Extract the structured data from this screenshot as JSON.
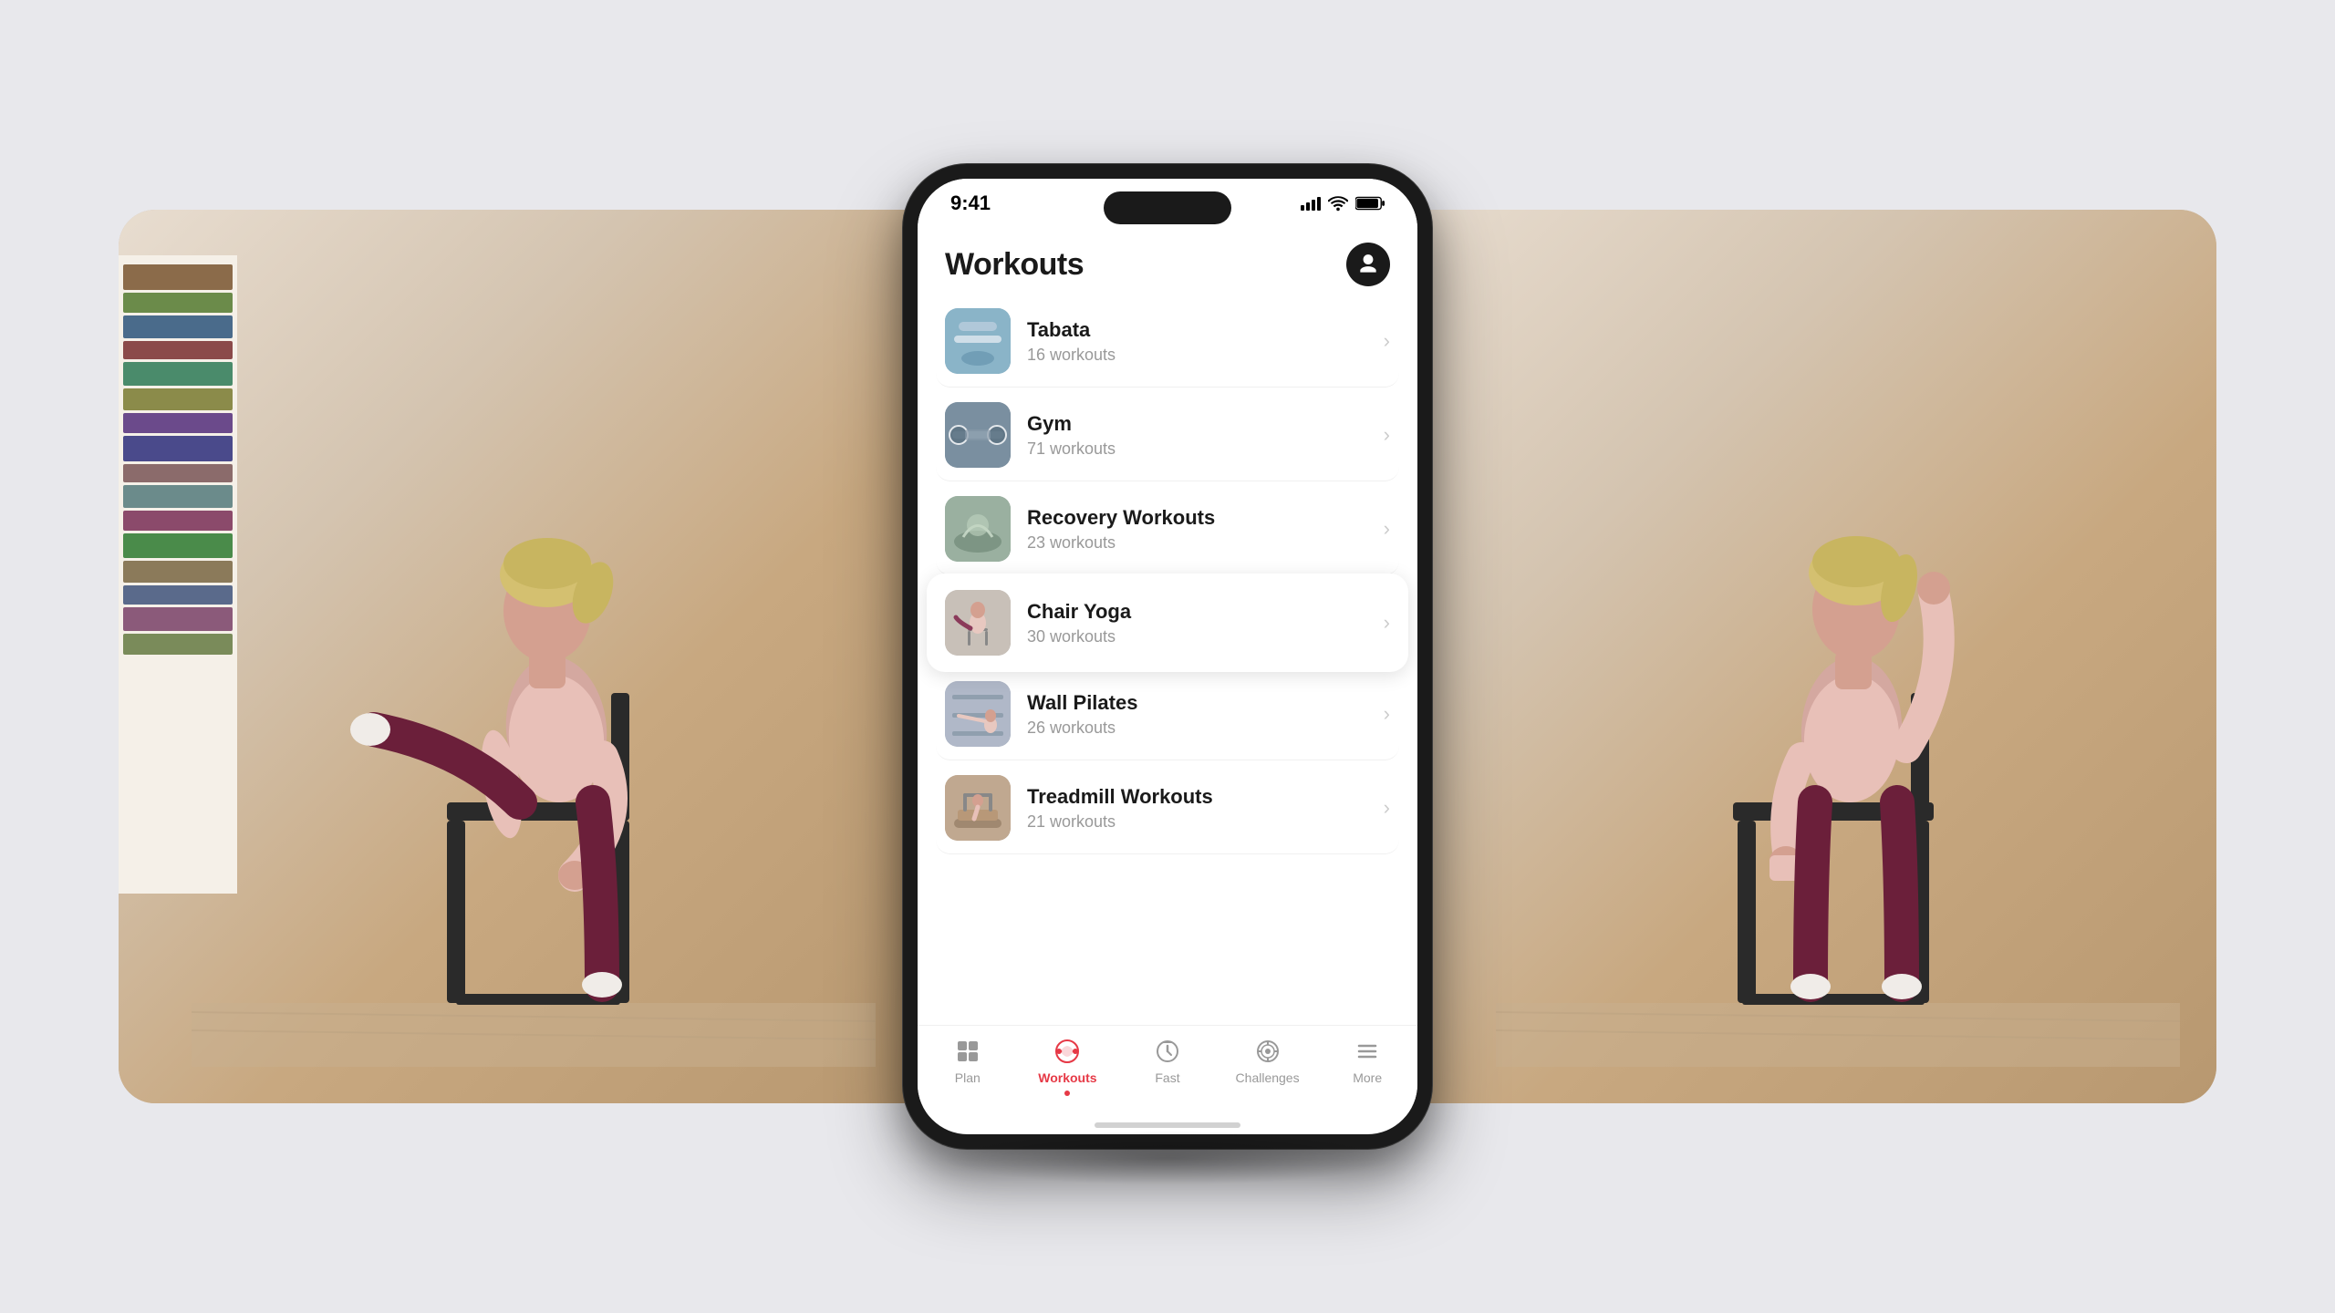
{
  "app": {
    "title": "Workouts",
    "time": "9:41"
  },
  "header": {
    "title": "Workouts",
    "profile_icon": "person-circle"
  },
  "workouts": [
    {
      "id": "tabata",
      "name": "Tabata",
      "count": "16 workouts",
      "thumb_class": "thumb-tabata",
      "highlighted": false
    },
    {
      "id": "gym",
      "name": "Gym",
      "count": "71 workouts",
      "thumb_class": "thumb-gym",
      "highlighted": false
    },
    {
      "id": "recovery",
      "name": "Recovery Workouts",
      "count": "23 workouts",
      "thumb_class": "thumb-recovery",
      "highlighted": false
    },
    {
      "id": "chair-yoga",
      "name": "Chair Yoga",
      "count": "30 workouts",
      "thumb_class": "thumb-chair-yoga",
      "highlighted": true
    },
    {
      "id": "wall-pilates",
      "name": "Wall Pilates",
      "count": "26 workouts",
      "thumb_class": "thumb-wall-pilates",
      "highlighted": false
    },
    {
      "id": "treadmill",
      "name": "Treadmill Workouts",
      "count": "21 workouts",
      "thumb_class": "thumb-treadmill",
      "highlighted": false
    }
  ],
  "tabs": [
    {
      "id": "plan",
      "label": "Plan",
      "active": false,
      "icon": "grid-icon"
    },
    {
      "id": "workouts",
      "label": "Workouts",
      "active": true,
      "icon": "dumbbell-icon"
    },
    {
      "id": "fast",
      "label": "Fast",
      "active": false,
      "icon": "timer-icon"
    },
    {
      "id": "challenges",
      "label": "Challenges",
      "active": false,
      "icon": "target-icon"
    },
    {
      "id": "more",
      "label": "More",
      "active": false,
      "icon": "menu-icon"
    }
  ],
  "colors": {
    "accent": "#e63946",
    "bg": "#e8e8ec",
    "panel_bg": "#c8b8a2",
    "active_tab": "#e63946"
  }
}
